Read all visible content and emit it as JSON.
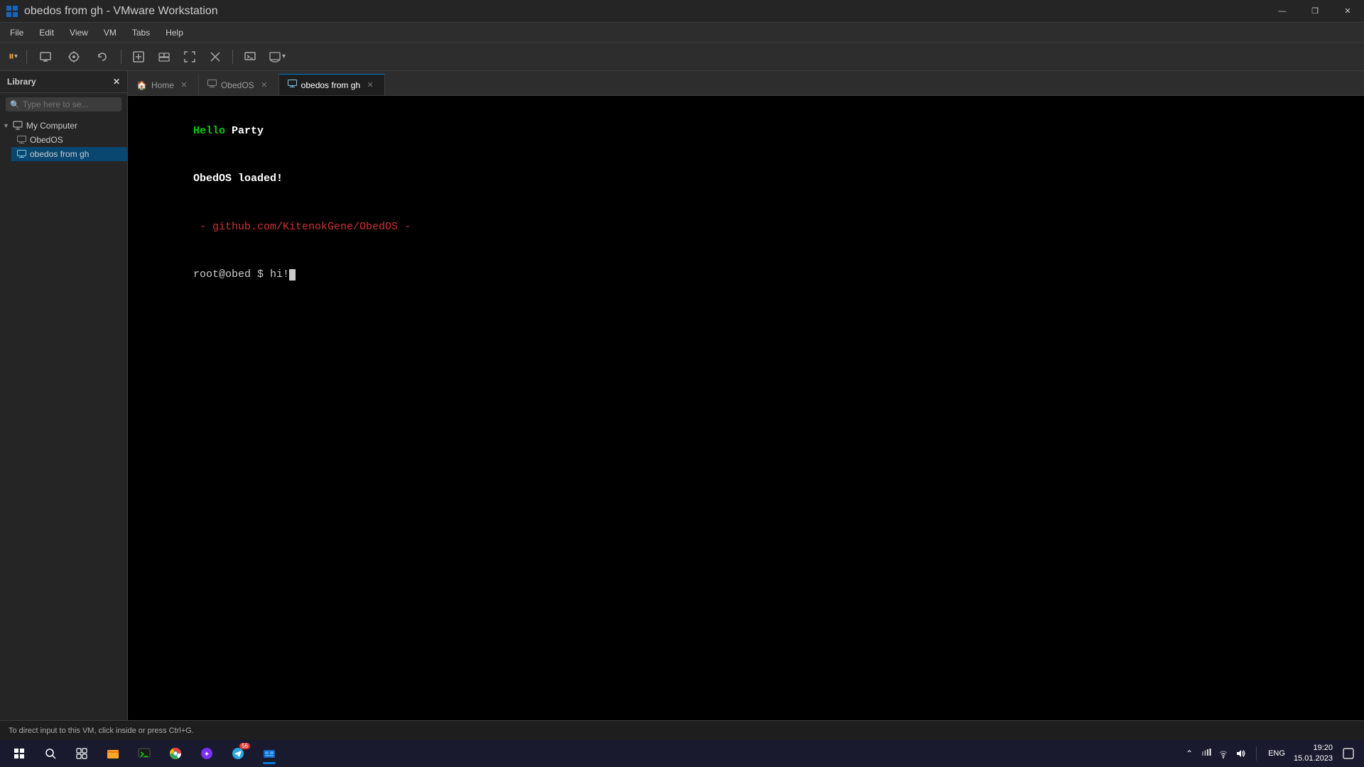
{
  "titlebar": {
    "title": "obedos from gh - VMware Workstation",
    "icon": "▣",
    "min_btn": "—",
    "max_btn": "❐",
    "close_btn": "✕"
  },
  "menubar": {
    "items": [
      "File",
      "Edit",
      "View",
      "VM",
      "Tabs",
      "Help"
    ]
  },
  "toolbar": {
    "pause_label": "⏸",
    "buttons": [
      "⊡",
      "↩",
      "⊙",
      "⊙",
      "▣",
      "▭",
      "⊠",
      "✕",
      "▤",
      "⚙"
    ]
  },
  "sidebar": {
    "title": "Library",
    "close_icon": "✕",
    "search_placeholder": "Type here to se...",
    "tree": {
      "root_label": "My Computer",
      "children": [
        {
          "label": "ObedOS",
          "icon": "🖥"
        },
        {
          "label": "obedos from gh",
          "icon": "🖥",
          "selected": true
        }
      ]
    }
  },
  "tabs": [
    {
      "label": "Home",
      "icon": "🏠",
      "active": false
    },
    {
      "label": "ObedOS",
      "icon": "🖥",
      "active": false
    },
    {
      "label": "obedos from gh",
      "icon": "▤",
      "active": true
    }
  ],
  "terminal": {
    "lines": [
      {
        "type": "hello",
        "green": "Hello ",
        "white": "Party"
      },
      {
        "type": "plain",
        "white": "ObedOS loaded!"
      },
      {
        "type": "link",
        "red": " - github.com/KitenokGene/ObedOS -"
      },
      {
        "type": "prompt",
        "text": "root@obed $ hi!"
      }
    ]
  },
  "statusbar": {
    "text": "To direct input to this VM, click inside or press Ctrl+G."
  },
  "taskbar": {
    "clock_time": "19:20",
    "clock_date": "15.01.2023",
    "lang": "ENG",
    "apps": [
      {
        "label": "Start",
        "type": "start"
      },
      {
        "label": "Search",
        "type": "search"
      },
      {
        "label": "TaskView",
        "type": "taskview"
      },
      {
        "label": "Explorer",
        "type": "explorer"
      },
      {
        "label": "Terminal",
        "type": "terminal"
      },
      {
        "label": "Chrome",
        "type": "chrome"
      },
      {
        "label": "Copilot",
        "type": "copilot"
      },
      {
        "label": "Telegram",
        "type": "telegram"
      },
      {
        "label": "VMware",
        "type": "vmware",
        "active": true
      }
    ]
  }
}
